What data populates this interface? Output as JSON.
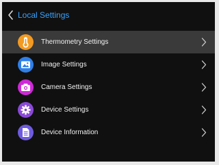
{
  "header": {
    "title": "Local Settings",
    "back_icon": "chevron-left-icon",
    "title_color": "#3aa3ff"
  },
  "menu": {
    "items": [
      {
        "label": "Thermometry  Settings",
        "icon": "thermometer-icon",
        "color": "#f29a22",
        "selected": true
      },
      {
        "label": "Image  Settings",
        "icon": "image-icon",
        "color": "#2f7fe8",
        "selected": false
      },
      {
        "label": "Camera  Settings",
        "icon": "camera-icon",
        "color": "#cc2ad6",
        "selected": false
      },
      {
        "label": "Device  Settings",
        "icon": "gear-icon",
        "color": "#8a49d8",
        "selected": false
      },
      {
        "label": "Device Information",
        "icon": "document-icon",
        "color": "#6f5be0",
        "selected": false
      }
    ]
  }
}
